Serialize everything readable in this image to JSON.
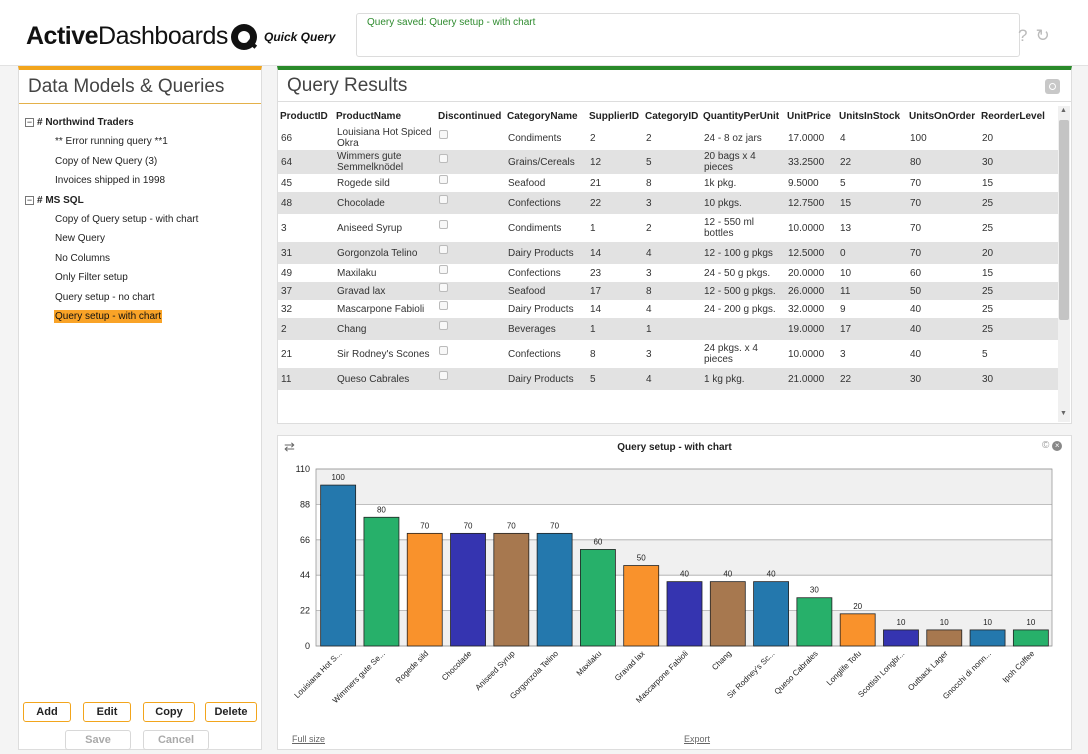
{
  "header": {
    "brand_bold": "Active",
    "brand_rest": "Dashboards",
    "product": "Quick Query",
    "message": "Query saved: Query setup - with chart",
    "help_icon": "question-icon",
    "refresh_icon": "refresh-icon"
  },
  "sidebar": {
    "title": "Data Models & Queries",
    "groups": [
      {
        "label": "# Northwind Traders",
        "items": [
          {
            "label": "** Error running query **1"
          },
          {
            "label": "Copy of New Query (3)"
          },
          {
            "label": "Invoices shipped in 1998"
          }
        ]
      },
      {
        "label": "# MS SQL",
        "items": [
          {
            "label": "Copy of Query setup - with chart"
          },
          {
            "label": "New Query"
          },
          {
            "label": "No Columns"
          },
          {
            "label": "Only Filter setup"
          },
          {
            "label": "Query setup - no chart"
          },
          {
            "label": "Query setup - with chart",
            "selected": true
          }
        ]
      }
    ],
    "buttons": {
      "add": "Add",
      "edit": "Edit",
      "copy": "Copy",
      "delete": "Delete",
      "save": "Save",
      "cancel": "Cancel"
    }
  },
  "results": {
    "title": "Query Results",
    "columns": [
      "ProductID",
      "ProductName",
      "Discontinued",
      "CategoryName",
      "SupplierID",
      "CategoryID",
      "QuantityPerUnit",
      "UnitPrice",
      "UnitsInStock",
      "UnitsOnOrder",
      "ReorderLevel"
    ],
    "rows": [
      [
        "66",
        "Louisiana Hot Spiced Okra",
        "",
        "Condiments",
        "2",
        "2",
        "24 - 8 oz jars",
        "17.0000",
        "4",
        "100",
        "20"
      ],
      [
        "64",
        "Wimmers gute Semmelknödel",
        "",
        "Grains/Cereals",
        "12",
        "5",
        "20 bags x 4 pieces",
        "33.2500",
        "22",
        "80",
        "30"
      ],
      [
        "45",
        "Rogede sild",
        "",
        "Seafood",
        "21",
        "8",
        "1k pkg.",
        "9.5000",
        "5",
        "70",
        "15"
      ],
      [
        "48",
        "Chocolade",
        "",
        "Confections",
        "22",
        "3",
        "10 pkgs.",
        "12.7500",
        "15",
        "70",
        "25"
      ],
      [
        "3",
        "Aniseed Syrup",
        "",
        "Condiments",
        "1",
        "2",
        "12 - 550 ml bottles",
        "10.0000",
        "13",
        "70",
        "25"
      ],
      [
        "31",
        "Gorgonzola Telino",
        "",
        "Dairy Products",
        "14",
        "4",
        "12 - 100 g pkgs",
        "12.5000",
        "0",
        "70",
        "20"
      ],
      [
        "49",
        "Maxilaku",
        "",
        "Confections",
        "23",
        "3",
        "24 - 50 g pkgs.",
        "20.0000",
        "10",
        "60",
        "15"
      ],
      [
        "37",
        "Gravad lax",
        "",
        "Seafood",
        "17",
        "8",
        "12 - 500 g pkgs.",
        "26.0000",
        "11",
        "50",
        "25"
      ],
      [
        "32",
        "Mascarpone Fabioli",
        "",
        "Dairy Products",
        "14",
        "4",
        "24 - 200 g pkgs.",
        "32.0000",
        "9",
        "40",
        "25"
      ],
      [
        "2",
        "Chang",
        "",
        "Beverages",
        "1",
        "1",
        "",
        "19.0000",
        "17",
        "40",
        "25"
      ],
      [
        "21",
        "Sir Rodney's Scones",
        "",
        "Confections",
        "8",
        "3",
        "24 pkgs. x 4 pieces",
        "10.0000",
        "3",
        "40",
        "5"
      ],
      [
        "11",
        "Queso Cabrales",
        "",
        "Dairy Products",
        "5",
        "4",
        "1 kg pkg.",
        "21.0000",
        "22",
        "30",
        "30"
      ]
    ]
  },
  "chart_panel": {
    "full_size": "Full size",
    "export": "Export"
  },
  "chart_data": {
    "type": "bar",
    "title": "Query setup - with chart",
    "categories": [
      "Louisiana Hot S...",
      "Wimmers gute Se...",
      "Rogede sild",
      "Chocolade",
      "Aniseed Syrup",
      "Gorgonzola Telino",
      "Maxilaku",
      "Gravad lax",
      "Mascarpone Fabioli",
      "Chang",
      "Sir Rodney's Sc...",
      "Queso Cabrales",
      "Longlife Tofu",
      "Scottish Longbr...",
      "Outback Lager",
      "Gnocchi di nonn...",
      "Ipoh Coffee"
    ],
    "values": [
      100,
      80,
      70,
      70,
      70,
      70,
      60,
      50,
      40,
      40,
      40,
      30,
      20,
      10,
      10,
      10,
      10
    ],
    "colors": [
      "#2478ad",
      "#27b06a",
      "#f9922c",
      "#3534b0",
      "#a7784f",
      "#2478ad",
      "#27b06a",
      "#f9922c",
      "#3534b0",
      "#a7784f",
      "#2478ad",
      "#27b06a",
      "#f9922c",
      "#3534b0",
      "#a7784f",
      "#2478ad",
      "#27b06a"
    ],
    "yticks": [
      0,
      22,
      44,
      66,
      88,
      110
    ],
    "ylim": [
      0,
      110
    ],
    "grid": true
  }
}
